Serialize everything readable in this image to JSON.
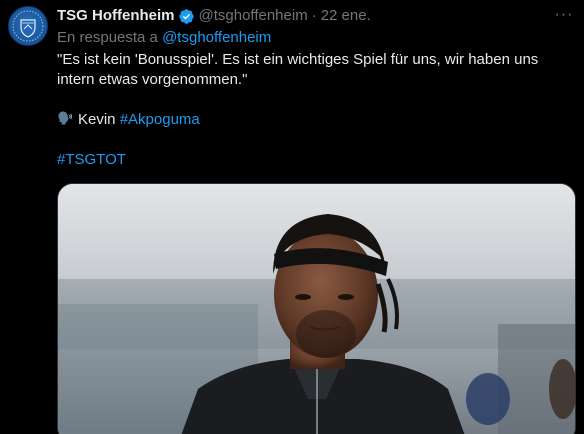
{
  "tweet": {
    "author_name": "TSG Hoffenheim",
    "handle": "@tsghoffenheim",
    "separator": "·",
    "date": "22 ene.",
    "more_label": "···",
    "reply_prefix": "En respuesta a",
    "reply_handle": "@tsghoffenheim",
    "text_line1": "\"Es ist kein 'Bonusspiel'. Es ist ein wichtiges Spiel für uns, wir haben uns intern etwas vorgenommen.\"",
    "speaker_name": "Kevin",
    "speaker_hashtag": "#Akpoguma",
    "hashtag": "#TSGTOT"
  },
  "colors": {
    "background": "#000000",
    "text_primary": "#e7e9ea",
    "text_secondary": "#71767b",
    "link": "#1d9bf0",
    "verified": "#1d9bf0",
    "avatar": "#1b5aa0"
  },
  "icons": {
    "verified": "verified-badge-icon",
    "speaker": "speaking-head-icon",
    "more": "more-options-icon"
  }
}
